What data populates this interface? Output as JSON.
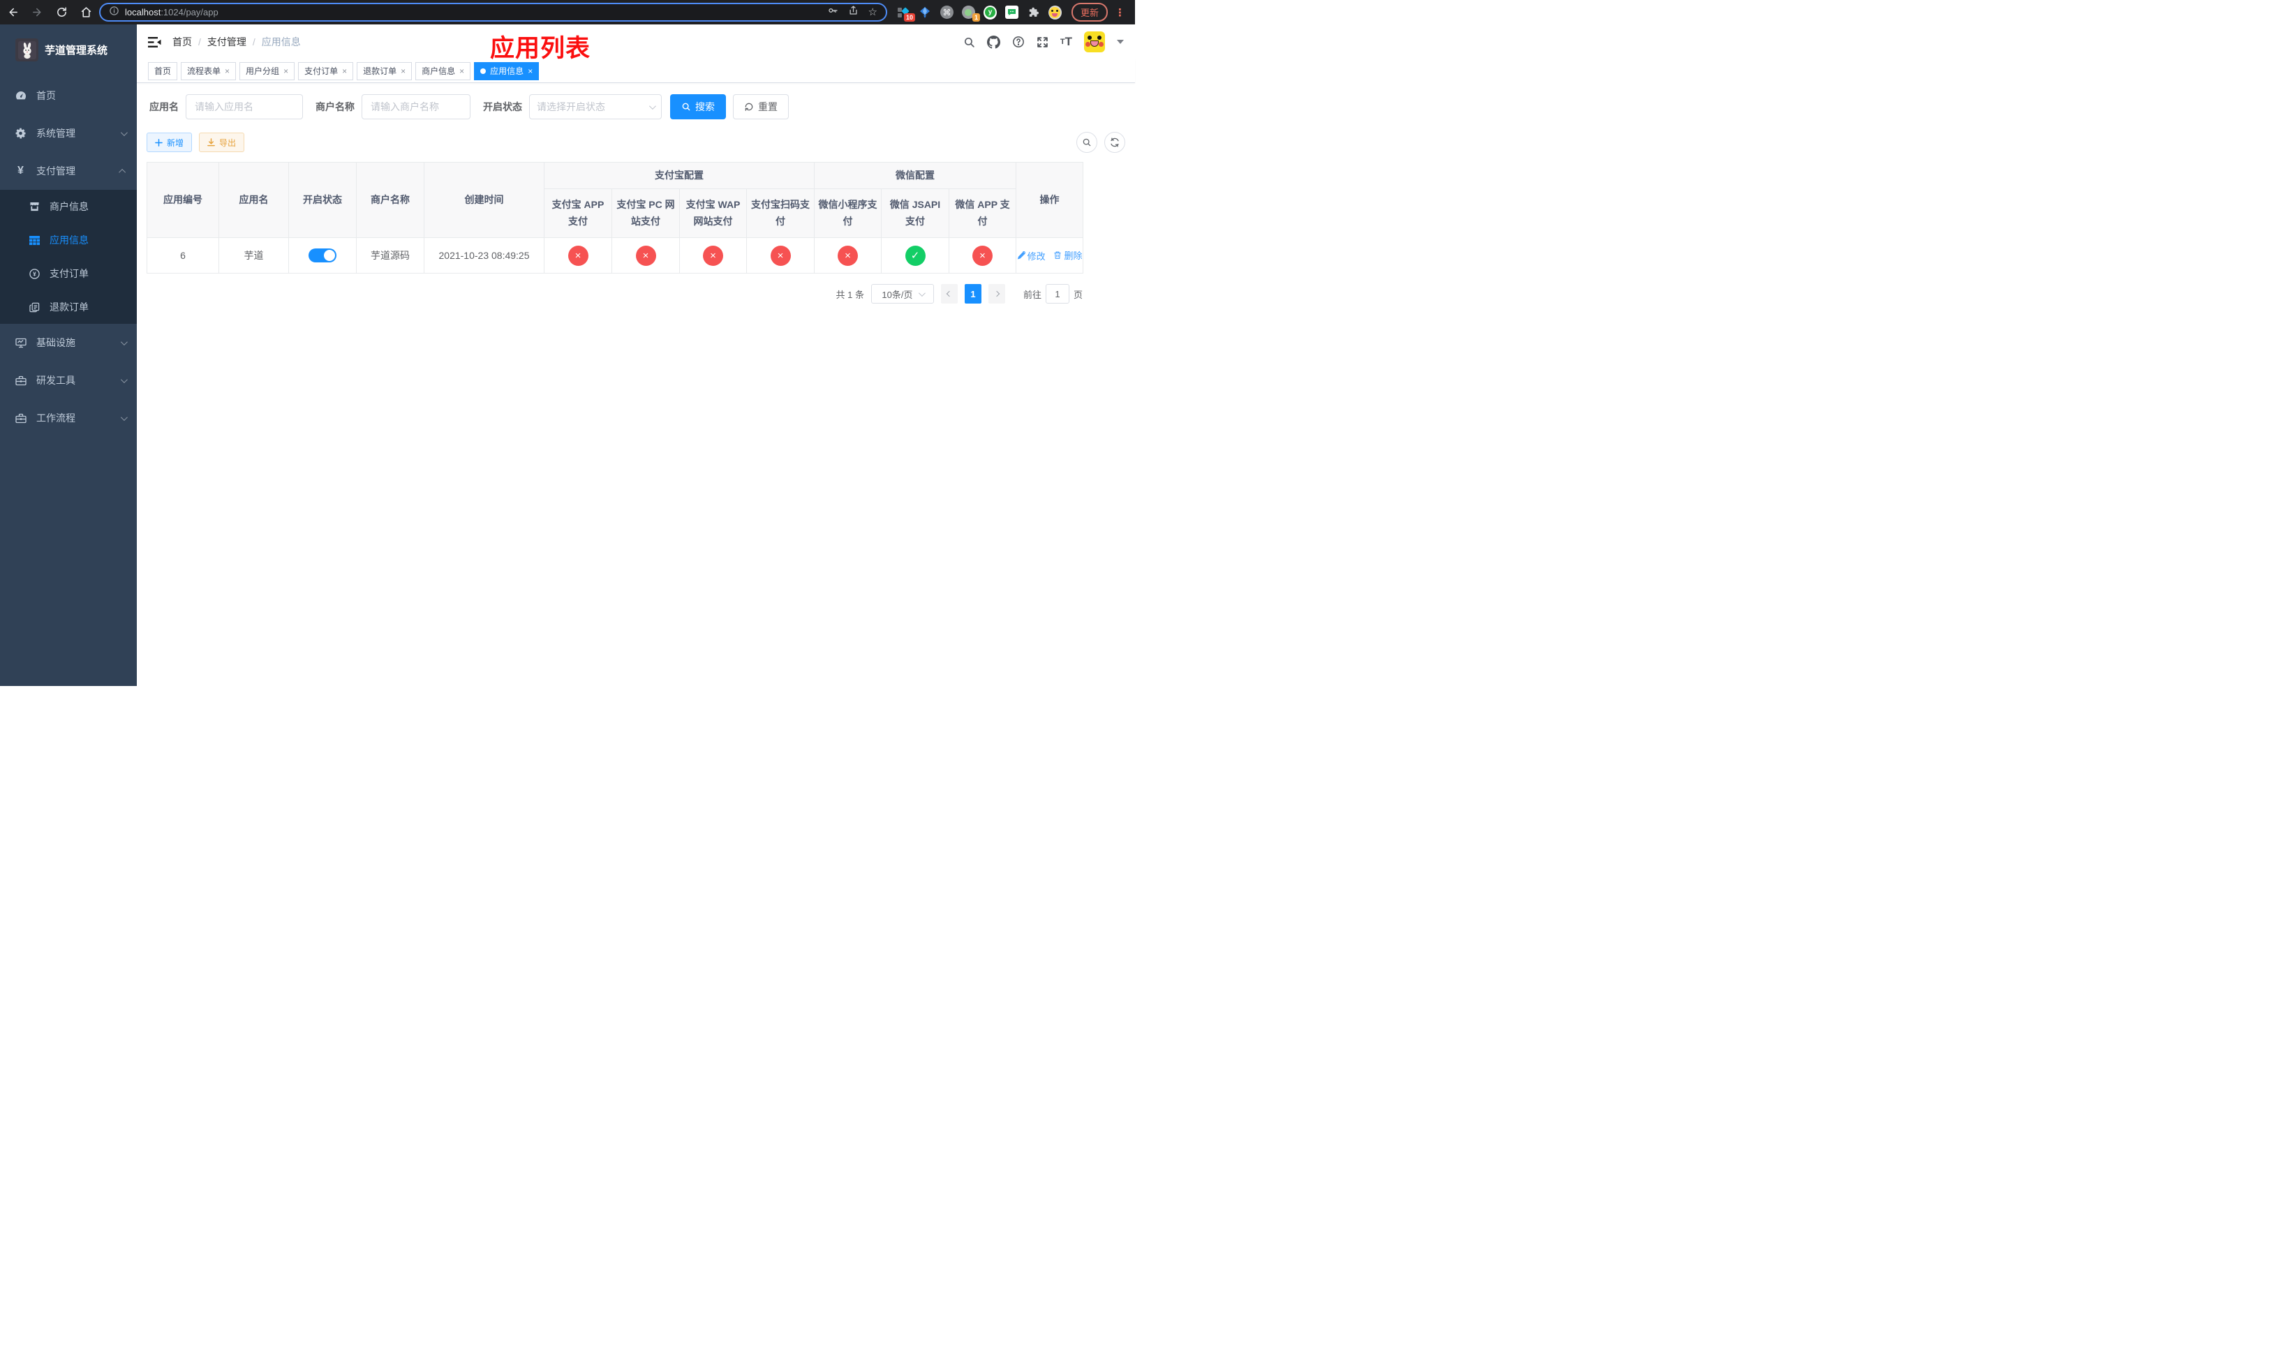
{
  "colors": {
    "accent": "#1890ff",
    "sidebar_bg": "#304156",
    "submenu_bg": "#1f2d3d",
    "annotation_red": "#fb0f0f",
    "status_no": "#f65252",
    "status_yes": "#13ce66",
    "warning": "#e6a23c"
  },
  "browser": {
    "url_host": "localhost",
    "url_path": ":1024/pay/app",
    "update_label": "更新",
    "extension_badge_1": "10",
    "extension_badge_2": "1"
  },
  "sidebar": {
    "title": "芋道管理系统",
    "items": [
      {
        "label": "首页"
      },
      {
        "label": "系统管理"
      },
      {
        "label": "支付管理"
      },
      {
        "label": "商户信息"
      },
      {
        "label": "应用信息"
      },
      {
        "label": "支付订单"
      },
      {
        "label": "退款订单"
      },
      {
        "label": "基础设施"
      },
      {
        "label": "研发工具"
      },
      {
        "label": "工作流程"
      }
    ]
  },
  "navbar": {
    "breadcrumb": {
      "separator": "/",
      "items": [
        "首页",
        "支付管理",
        "应用信息"
      ]
    },
    "annotation": "应用列表"
  },
  "tags": [
    {
      "label": "首页"
    },
    {
      "label": "流程表单"
    },
    {
      "label": "用户分组"
    },
    {
      "label": "支付订单"
    },
    {
      "label": "退款订单"
    },
    {
      "label": "商户信息"
    },
    {
      "label": "应用信息"
    }
  ],
  "filters": {
    "app_name": {
      "label": "应用名",
      "placeholder": "请输入应用名",
      "value": ""
    },
    "merchant_name": {
      "label": "商户名称",
      "placeholder": "请输入商户名称",
      "value": ""
    },
    "status": {
      "label": "开启状态",
      "placeholder": "请选择开启状态"
    },
    "search_label": "搜索",
    "reset_label": "重置"
  },
  "toolbar": {
    "add_label": "新增",
    "export_label": "导出"
  },
  "table": {
    "columns": [
      "应用编号",
      "应用名",
      "开启状态",
      "商户名称",
      "创建时间"
    ],
    "groups": {
      "alipay": "支付宝配置",
      "wechat": "微信配置"
    },
    "alipay_columns": [
      "支付宝 APP 支付",
      "支付宝 PC 网站支付",
      "支付宝 WAP 网站支付",
      "支付宝扫码支付"
    ],
    "wechat_columns": [
      "微信小程序支付",
      "微信 JSAPI 支付",
      "微信 APP 支付"
    ],
    "ops_column": "操作",
    "rows": [
      {
        "id": "6",
        "name": "芋道",
        "enabled": true,
        "merchant": "芋道源码",
        "created": "2021-10-23 08:49:25",
        "statuses": [
          "no",
          "no",
          "no",
          "no",
          "no",
          "yes",
          "no"
        ],
        "edit_label": "修改",
        "delete_label": "删除"
      }
    ]
  },
  "pagination": {
    "total": "共 1 条",
    "page_size": "10条/页",
    "current_page": "1",
    "goto_label": "前往",
    "goto_value": "1",
    "unit_label": "页"
  }
}
